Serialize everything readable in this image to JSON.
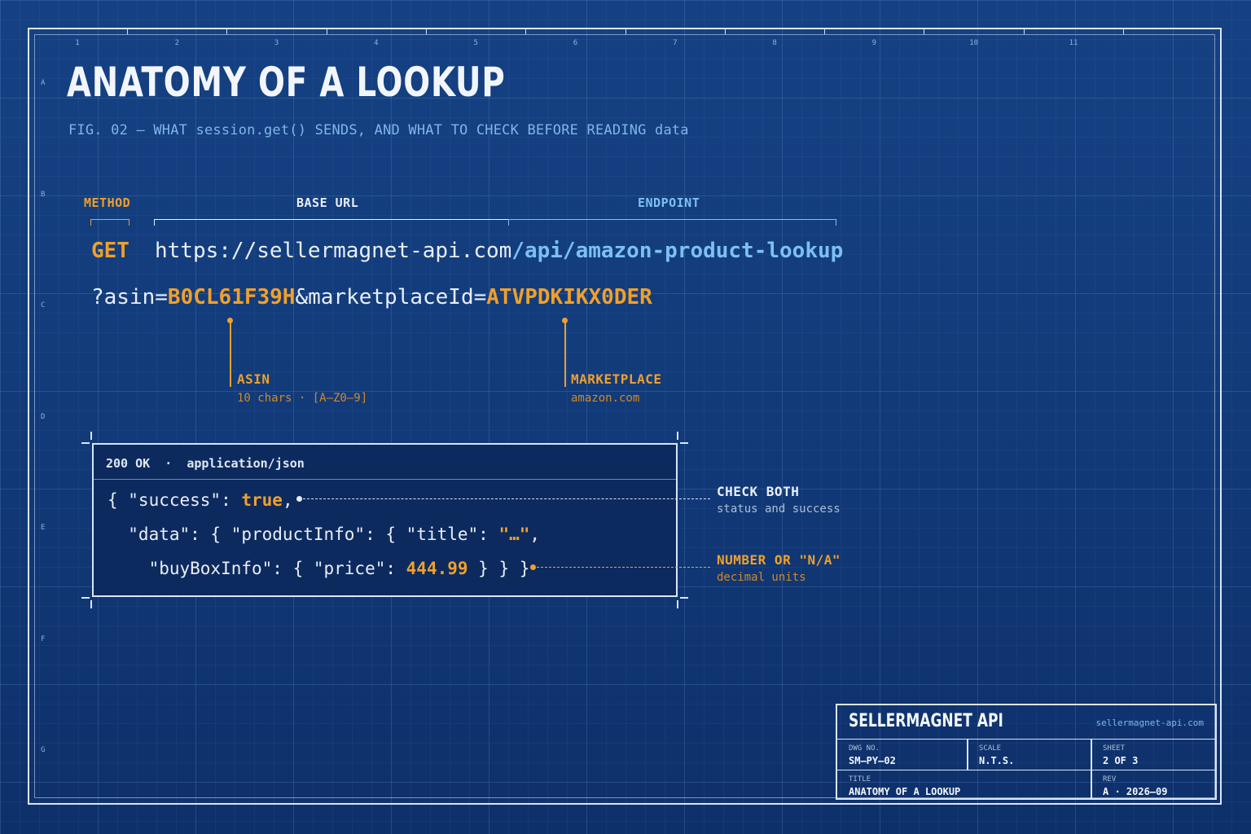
{
  "sheet": {
    "columns": [
      "1",
      "2",
      "3",
      "4",
      "5",
      "6",
      "7",
      "8",
      "9",
      "10",
      "11"
    ],
    "rows": [
      "A",
      "B",
      "C",
      "D",
      "E",
      "F",
      "G"
    ]
  },
  "header": {
    "title": "ANATOMY OF A LOOKUP",
    "fig_label": "FIG. 02  —  WHAT session.get() SENDS, AND WHAT TO CHECK BEFORE READING data"
  },
  "request": {
    "labels": {
      "method": "METHOD",
      "base_url": "BASE URL",
      "endpoint": "ENDPOINT"
    },
    "method": "GET",
    "base_url": "https://sellermagnet-api.com",
    "endpoint": "/api/amazon-product-lookup",
    "query": {
      "prefix": "?asin=",
      "asin": "B0CL61F39H",
      "separator": "&marketplaceId=",
      "marketplace_id": "ATVPDKIKX0DER"
    },
    "callouts": {
      "asin": {
        "title": "ASIN",
        "note": "10 chars · [A–Z0–9]"
      },
      "marketplace": {
        "title": "MARKETPLACE",
        "note": "amazon.com"
      }
    }
  },
  "response": {
    "header": "200 OK  ·  application/json",
    "line1": {
      "open": "{ \"success\": ",
      "value": "true",
      "close": ","
    },
    "line2": {
      "open": "  \"data\": { \"productInfo\": { \"title\": ",
      "value": "\"…\"",
      "close": ","
    },
    "line3": {
      "open": "    \"buyBoxInfo\": { \"price\": ",
      "value": "444.99",
      "close": " } } }"
    }
  },
  "notes": {
    "check": {
      "title": "CHECK BOTH",
      "sub": "status and success"
    },
    "price": {
      "title": "NUMBER OR \"N/A\"",
      "sub": "decimal units"
    }
  },
  "title_block": {
    "brand": "SELLERMAGNET API",
    "url": "sellermagnet-api.com",
    "dwg_label": "DWG NO.",
    "dwg_value": "SM–PY–02",
    "scale_label": "SCALE",
    "scale_value": "N.T.S.",
    "sheet_label": "SHEET",
    "sheet_value": "2 OF 3",
    "title_label": "TITLE",
    "title_value": "ANATOMY OF A LOOKUP",
    "rev_label": "REV",
    "rev_value": "A · 2026–09"
  },
  "colors": {
    "accent": "#f0a02a",
    "endpoint": "#7cc0f5",
    "background": "#123b7a",
    "line": "#d9e6f7"
  }
}
